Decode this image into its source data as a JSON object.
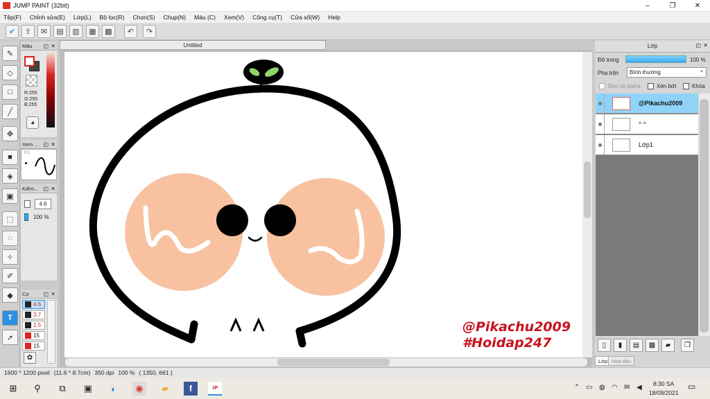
{
  "window": {
    "title": "JUMP PAINT (32bit)",
    "min": "–",
    "max": "❐",
    "close": "✕"
  },
  "menu": [
    "Tệp(F)",
    "Chỉnh sửa(E)",
    "Lớp(L)",
    "Bộ lọc(R)",
    "Chọn(S)",
    "Chụp(N)",
    "Màu (C)",
    "Xem(V)",
    "Công cụ(T)",
    "Cửa sổ(W)",
    "Help"
  ],
  "document": {
    "tab_title": "Untitled"
  },
  "panels": {
    "color": {
      "title": "Màu",
      "r": "R:255",
      "g": "G:255",
      "b": "B:255",
      "fg": "#ffffff",
      "bg": "#444444"
    },
    "preview": {
      "title": "Xem ...",
      "size": "0.1"
    },
    "pen": {
      "title": "Kiểm...",
      "size": "4.6",
      "opacity": "100 %"
    },
    "brush_size": {
      "title": "Cọ",
      "sizes": [
        "4.6",
        "3.7",
        "1.5",
        "15",
        "15"
      ]
    }
  },
  "layers_panel": {
    "title": "Lớp",
    "opacity_label": "Độ trong",
    "opacity_value": "100 %",
    "opacity_fraction": 1.0,
    "blend_label": "Pha trộn",
    "blend_value": "Bình thường",
    "protect_alpha": "Bảo vệ alpha",
    "clip": "Xén bớt",
    "lock": "Khóa",
    "layers": [
      {
        "name": "@Pikachu2009",
        "selected": true
      },
      {
        "name": "^ ^",
        "selected": false
      },
      {
        "name": "Lớp1",
        "selected": false
      }
    ],
    "tabs": [
      "Lớp",
      "Hoa tiêu"
    ]
  },
  "canvas_text": {
    "line1": "@Pikachu2009",
    "line2": "#Hoidap247",
    "eyes": "^ ^"
  },
  "status": {
    "size": "1600 * 1200 pixel",
    "physical": "(11.6 * 8.7cm)",
    "dpi": "350 dpi",
    "zoom": "100 %",
    "cursor": "( 1350, 661 )"
  },
  "taskbar": {
    "time": "8:30 SA",
    "date": "18/09/2021"
  },
  "colors": {
    "accent": "#2c8fe0",
    "cheek": "#f8c2a0",
    "leaf": "#8fd56a",
    "signature": "#c8121f"
  }
}
